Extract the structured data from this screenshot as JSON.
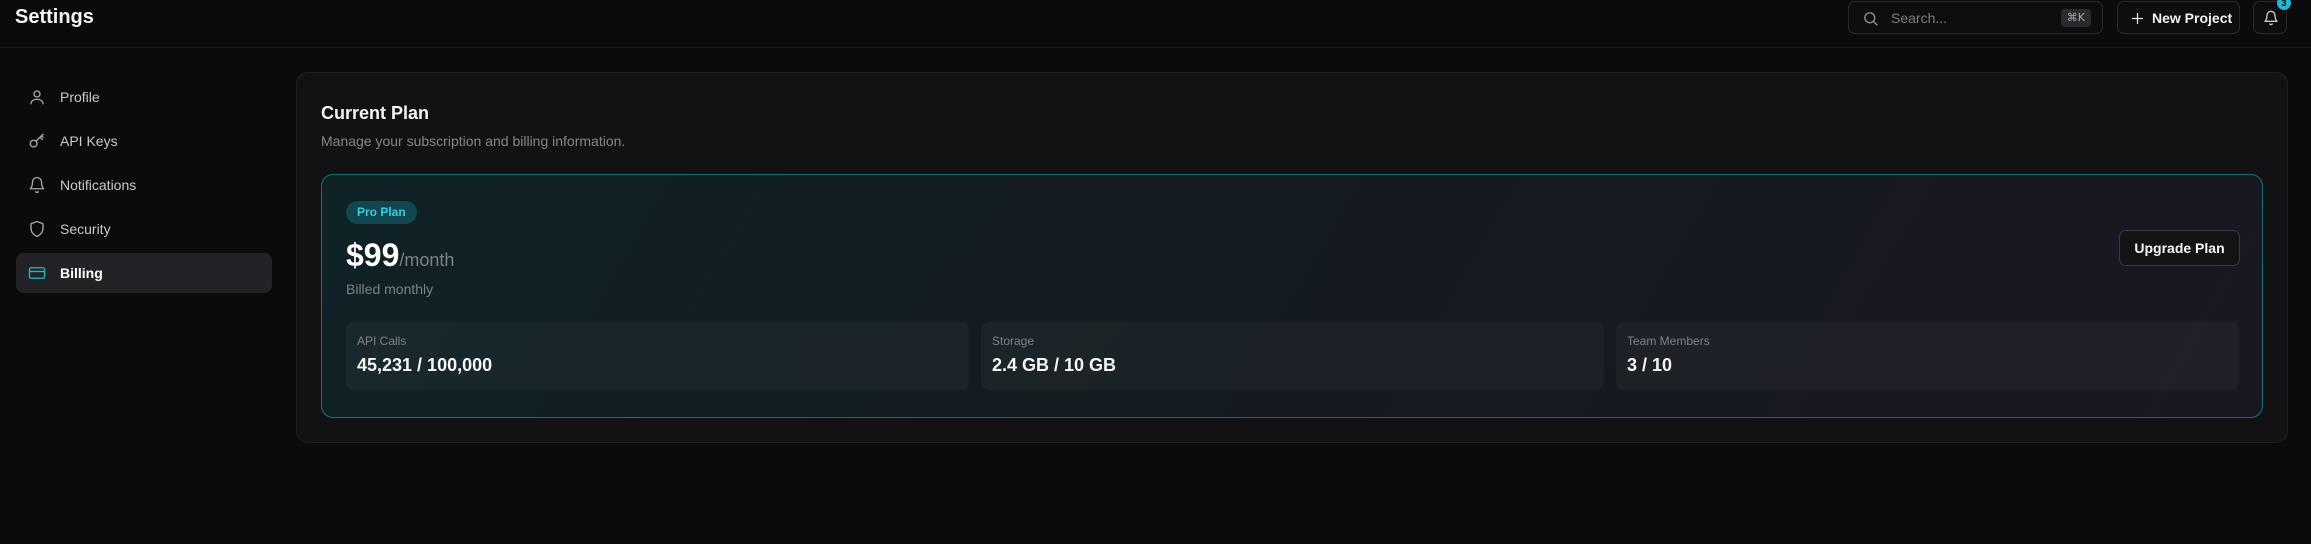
{
  "header": {
    "title": "Settings",
    "search_placeholder": "Search...",
    "search_shortcut": "⌘K",
    "new_project_label": "New Project",
    "notification_count": "3"
  },
  "sidebar": {
    "items": [
      {
        "label": "Profile",
        "icon": "user-icon",
        "active": false
      },
      {
        "label": "API Keys",
        "icon": "key-icon",
        "active": false
      },
      {
        "label": "Notifications",
        "icon": "bell-icon",
        "active": false
      },
      {
        "label": "Security",
        "icon": "shield-icon",
        "active": false
      },
      {
        "label": "Billing",
        "icon": "credit-card-icon",
        "active": true
      }
    ]
  },
  "main": {
    "title": "Current Plan",
    "subtitle": "Manage your subscription and billing information.",
    "plan": {
      "badge": "Pro Plan",
      "price": "$99",
      "period": "/month",
      "billing_note": "Billed monthly",
      "upgrade_label": "Upgrade Plan",
      "stats": [
        {
          "label": "API Calls",
          "value": "45,231 / 100,000"
        },
        {
          "label": "Storage",
          "value": "2.4 GB / 10 GB"
        },
        {
          "label": "Team Members",
          "value": "3 / 10"
        }
      ]
    }
  },
  "colors": {
    "accent": "#22b8cf",
    "background": "#0b0b0d",
    "panel": "#121214",
    "active_nav": "#232327",
    "plan_border": "#1b6f74"
  }
}
